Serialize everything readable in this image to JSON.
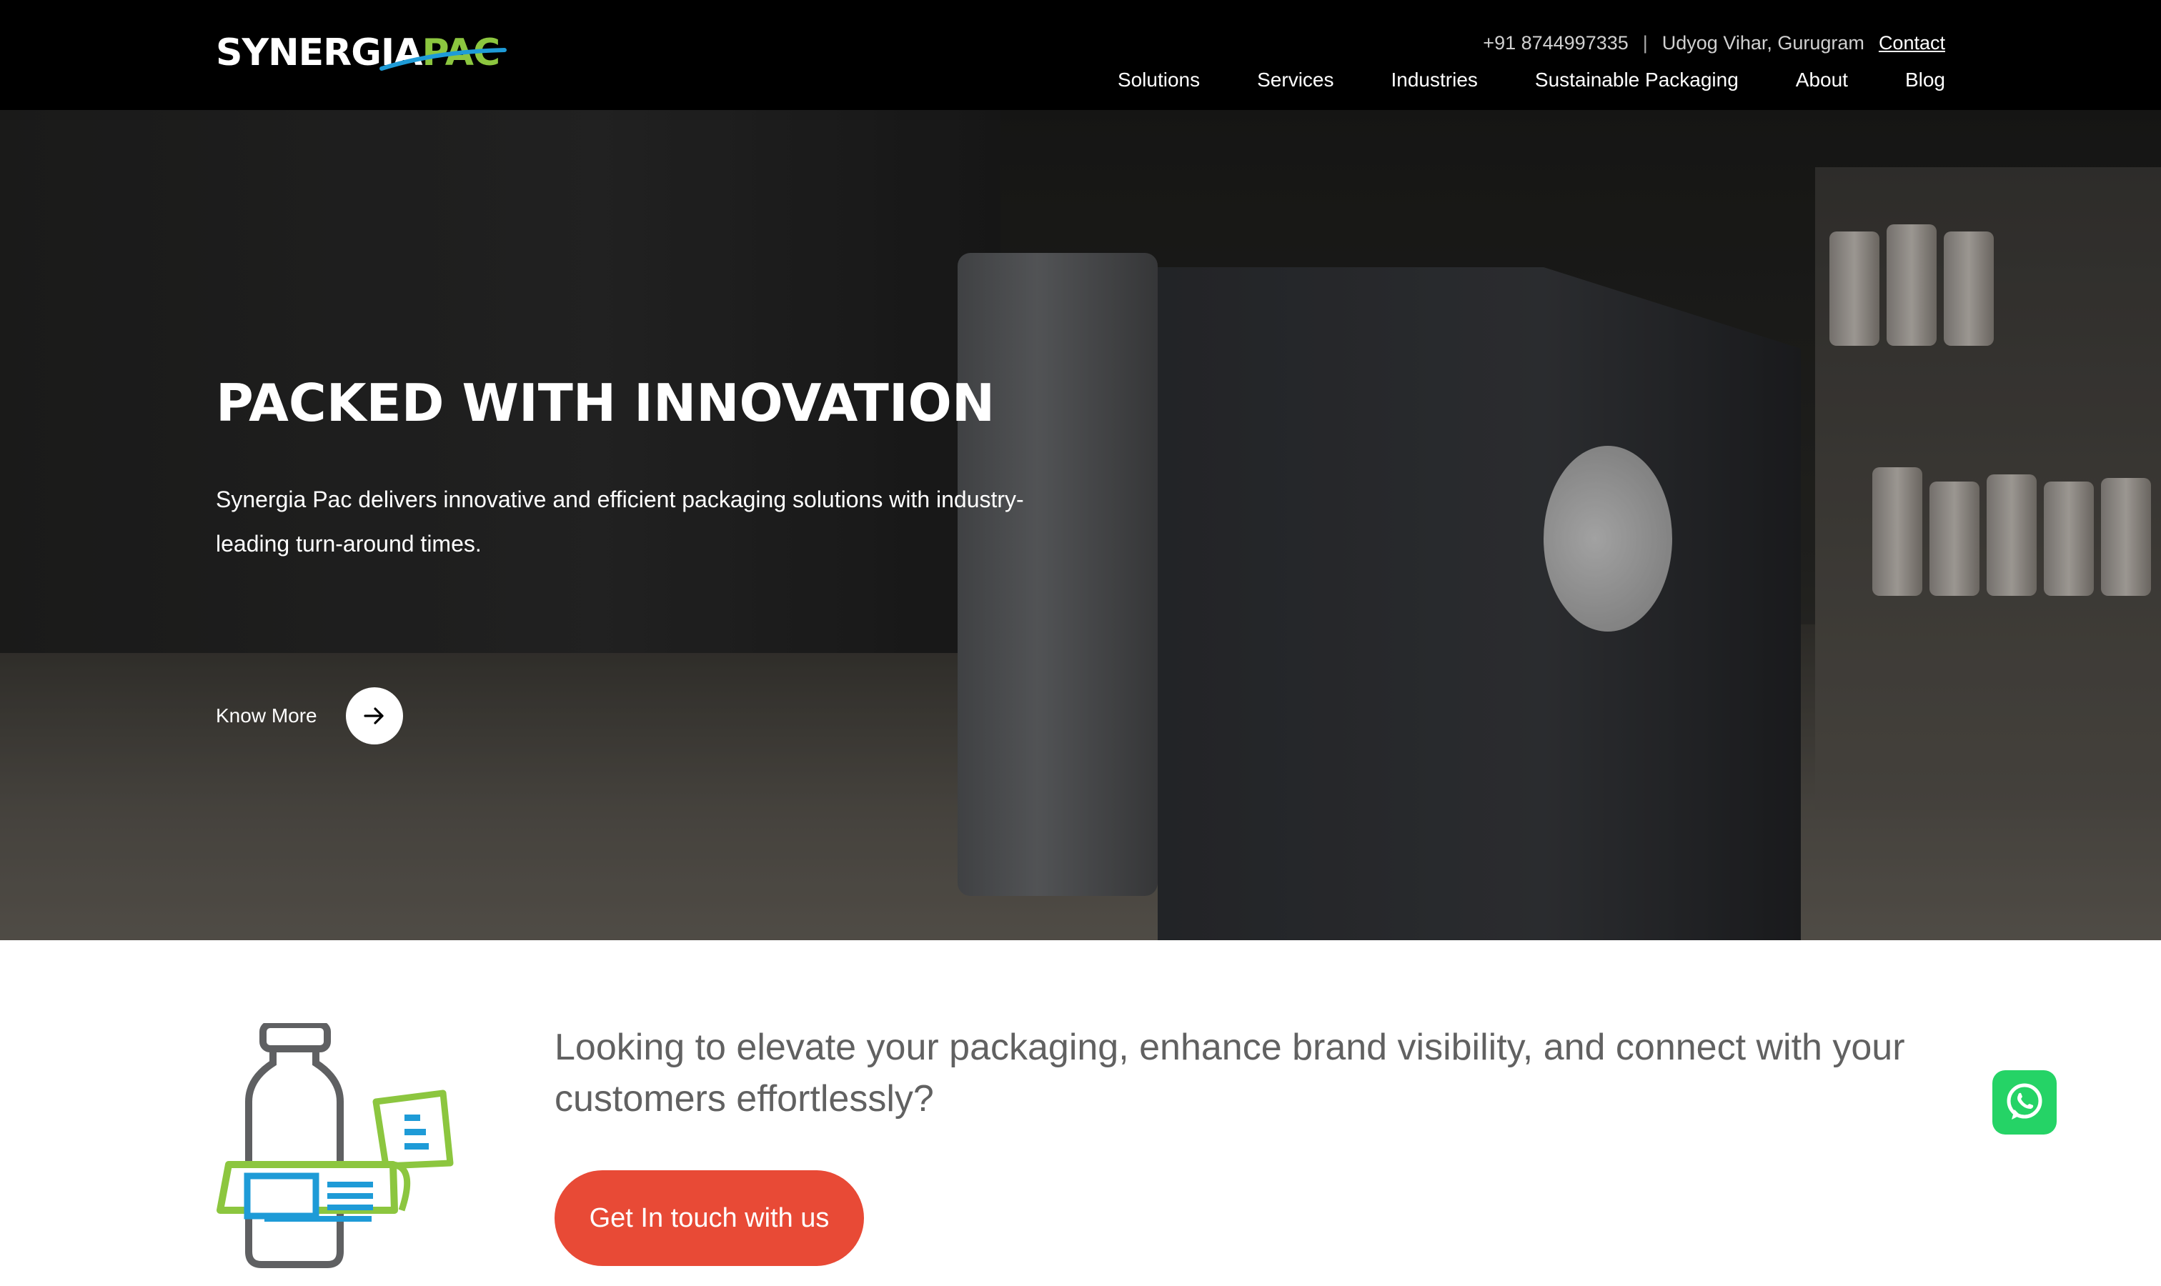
{
  "header": {
    "logo_part1": "SYNERGIA",
    "logo_part2": "PAC",
    "phone": "+91 8744997335",
    "separator": "|",
    "location": "Udyog Vihar, Gurugram",
    "contact_label": "Contact",
    "nav": [
      "Solutions",
      "Services",
      "Industries",
      "Sustainable Packaging",
      "About",
      "Blog"
    ]
  },
  "hero": {
    "title": "PACKED WITH INNOVATION",
    "description": "Synergia Pac delivers innovative and efficient packaging solutions with industry-leading turn-around times.",
    "cta_label": "Know More",
    "cta_icon": "arrow-right-icon"
  },
  "cta_section": {
    "illustration_icon": "packaging-label-icon",
    "text": "Looking to elevate your packaging, enhance brand visibility, and connect with your customers effortlessly?",
    "button_label": "Get In touch with us"
  },
  "floating": {
    "whatsapp_icon": "whatsapp-icon"
  },
  "colors": {
    "accent_green": "#8cc63f",
    "cta_red": "#e84a36",
    "whatsapp_green": "#25d366",
    "illustration_blue": "#1e9bd7",
    "illustration_gray": "#5f6062"
  }
}
